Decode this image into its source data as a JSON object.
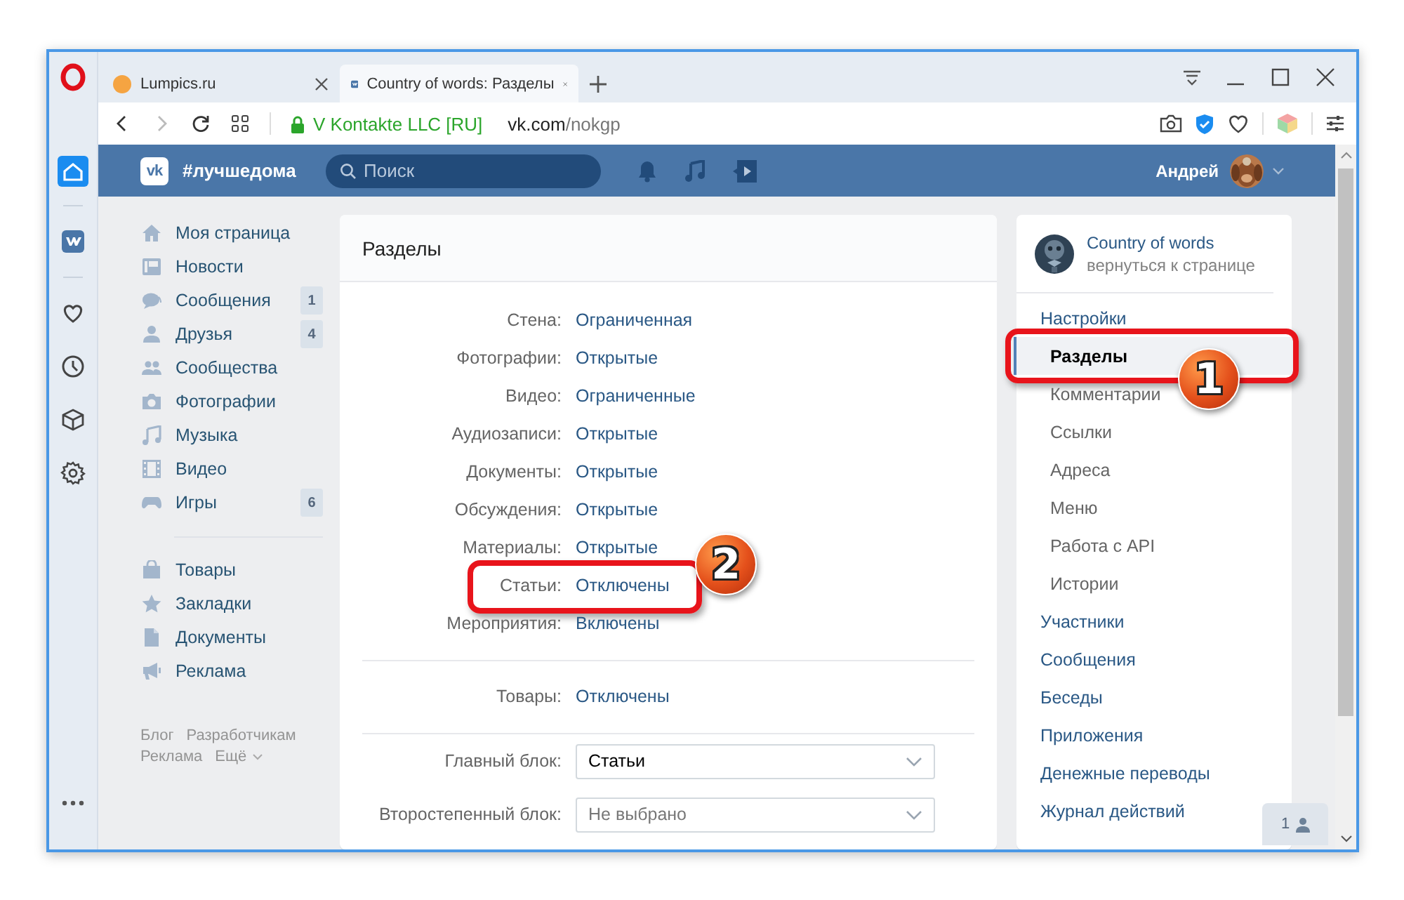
{
  "browser": {
    "tabs": [
      {
        "title": "Lumpics.ru",
        "selected": false
      },
      {
        "title": "Country of words: Разделы",
        "selected": true
      }
    ],
    "sidebar": [
      {
        "selected": true
      },
      {
        "selected": false
      },
      {
        "selected": false
      },
      {
        "selected": false
      },
      {
        "selected": false
      },
      {
        "selected": false
      }
    ],
    "address": {
      "site_identity": "V Kontakte LLC [RU]",
      "url_host": "vk.com",
      "url_path": "/nokgp"
    }
  },
  "header": {
    "logo_mark": "vk",
    "brand": "#лучшедома",
    "search": {
      "placeholder": "Поиск"
    },
    "user_name": "Андрей"
  },
  "left_nav": {
    "groups": [
      [
        {
          "label": "Моя страница"
        },
        {
          "label": "Новости"
        },
        {
          "label": "Сообщения",
          "count": "1"
        },
        {
          "label": "Друзья",
          "count": "4"
        },
        {
          "label": "Сообщества"
        },
        {
          "label": "Фотографии"
        },
        {
          "label": "Музыка"
        },
        {
          "label": "Видео"
        },
        {
          "label": "Игры",
          "count": "6"
        }
      ],
      [
        {
          "label": "Товары"
        },
        {
          "label": "Закладки"
        },
        {
          "label": "Документы"
        },
        {
          "label": "Реклама"
        }
      ]
    ],
    "footer": [
      {
        "label": "Блог",
        "kind": "link"
      },
      {
        "label": "Разработчикам",
        "kind": "link"
      },
      {
        "label": "Реклама",
        "kind": "link"
      },
      {
        "label": "Ещё",
        "kind": "menu"
      }
    ]
  },
  "sections": {
    "title": "Разделы",
    "groups": [
      [
        {
          "label": "Стена:",
          "value": "Ограниченная"
        },
        {
          "label": "Фотографии:",
          "value": "Открытые"
        },
        {
          "label": "Видео:",
          "value": "Ограниченные"
        },
        {
          "label": "Аудиозаписи:",
          "value": "Открытые"
        },
        {
          "label": "Документы:",
          "value": "Открытые"
        },
        {
          "label": "Обсуждения:",
          "value": "Открытые"
        },
        {
          "label": "Материалы:",
          "value": "Открытые"
        },
        {
          "label": "Статьи:",
          "value": "Отключены",
          "marker": "2"
        },
        {
          "label": "Мероприятия:",
          "value": "Включены"
        }
      ],
      [
        {
          "label": "Товары:",
          "value": "Отключены"
        }
      ]
    ],
    "selects": [
      {
        "label": "Главный блок:",
        "value": "Статьи"
      },
      {
        "label": "Второстепенный блок:",
        "placeholder": "Не выбрано"
      }
    ]
  },
  "community": {
    "name": "Country of words",
    "back_link": "вернуться к странице"
  },
  "settings_nav": [
    {
      "label": "Настройки",
      "selected": false,
      "children": [
        {
          "label": "Разделы",
          "selected": true,
          "marker": "1"
        },
        {
          "label": "Комментарии",
          "selected": false
        },
        {
          "label": "Ссылки",
          "selected": false
        },
        {
          "label": "Адреса",
          "selected": false
        },
        {
          "label": "Меню",
          "selected": false
        },
        {
          "label": "Работа с API",
          "selected": false
        },
        {
          "label": "Истории",
          "selected": false
        }
      ]
    },
    {
      "label": "Участники",
      "selected": false
    },
    {
      "label": "Сообщения",
      "selected": false
    },
    {
      "label": "Беседы",
      "selected": false
    },
    {
      "label": "Приложения",
      "selected": false
    },
    {
      "label": "Денежные переводы",
      "selected": false
    },
    {
      "label": "Журнал действий",
      "selected": false
    }
  ],
  "online_friends": {
    "count": "1"
  }
}
